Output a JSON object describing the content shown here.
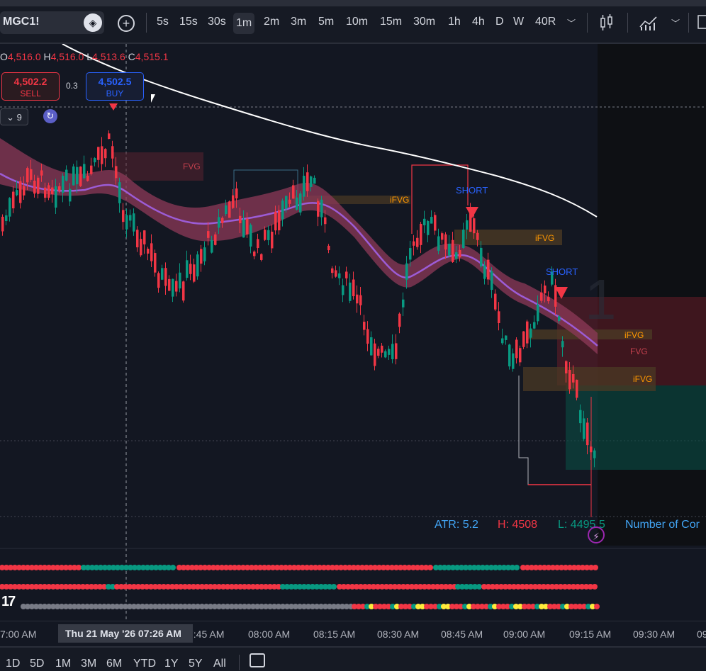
{
  "toolbar": {
    "symbol": "MGC1!",
    "intervals": [
      "5s",
      "15s",
      "30s",
      "1m",
      "2m",
      "3m",
      "5m",
      "10m",
      "15m",
      "30m",
      "1h",
      "4h",
      "D",
      "W",
      "40R"
    ],
    "active_interval": "1m",
    "icons": [
      "symbol-search-icon",
      "add-symbol-icon",
      "chevron-down-icon",
      "candles-icon",
      "indicators-icon",
      "chevron-down-icon"
    ]
  },
  "legend": {
    "o_label": "O",
    "o_value": "4,516.0",
    "h_label": "H",
    "h_value": "4,516.0",
    "l_label": "L",
    "l_value": "4,513.6",
    "c_label": "C",
    "c_value": "4,515.1"
  },
  "trading": {
    "sell_price": "4,502.2",
    "sell_label": "SELL",
    "spread": "0.3",
    "buy_price": "4,502.5",
    "buy_label": "BUY"
  },
  "indicators": {
    "collapse_count": "9"
  },
  "annotations": {
    "fvg": "FVG",
    "ifvg": "iFVG",
    "short": "SHORT",
    "watermark": "1"
  },
  "stats": {
    "atr": "ATR: 5.2",
    "high": "H: 4508",
    "low": "L: 4495.5",
    "contracts": "Number of Cor"
  },
  "time_axis": {
    "labels": [
      "7:00 AM",
      "7:45 AM",
      "08:00 AM",
      "08:15 AM",
      "08:30 AM",
      "08:45 AM",
      "09:00 AM",
      "09:15 AM",
      "09:30 AM",
      "09"
    ],
    "crosshair": "Thu 21 May '26   07:26 AM"
  },
  "range_buttons": [
    "1D",
    "5D",
    "1M",
    "3M",
    "6M",
    "YTD",
    "1Y",
    "5Y",
    "All"
  ],
  "colors": {
    "background": "#131722",
    "up": "#089981",
    "down": "#f23645",
    "ema_band": "#8e3a58",
    "ma_line": "#ffffff",
    "ifvg": "#ff9800",
    "short": "#2962ff"
  },
  "chart_data": {
    "type": "candlestick",
    "x": [
      "07:00",
      "07:15",
      "07:30",
      "07:45",
      "08:00",
      "08:15",
      "08:30",
      "08:45",
      "09:00",
      "09:15"
    ],
    "approx_close": [
      4513.5,
      4511.0,
      4507.5,
      4510.5,
      4512.0,
      4503.0,
      4508.5,
      4507.5,
      4500.0,
      4502.5
    ],
    "ma_line": [
      4516.5,
      4515.5,
      4514.5,
      4514.0,
      4513.5,
      4513.0,
      4512.5,
      4512.0,
      4511.0
    ],
    "current_price": 4502.5
  }
}
